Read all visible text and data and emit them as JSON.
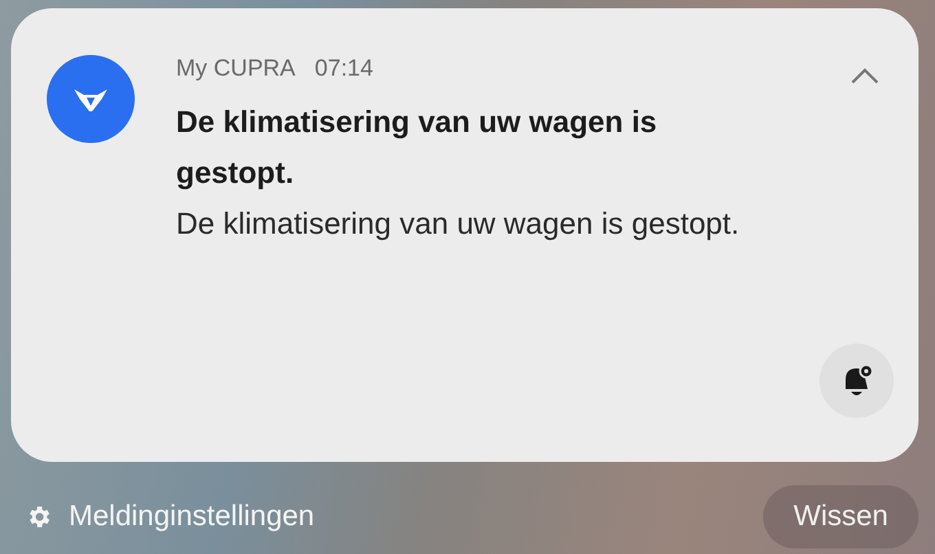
{
  "notification": {
    "app_name": "My CUPRA",
    "time": "07:14",
    "title": "De klimatisering van uw wagen is gestopt.",
    "body": "De klimatisering van uw wagen is gestopt.",
    "expanded": true
  },
  "footer": {
    "settings_label": "Meldinginstellingen",
    "clear_button": "Wissen"
  }
}
